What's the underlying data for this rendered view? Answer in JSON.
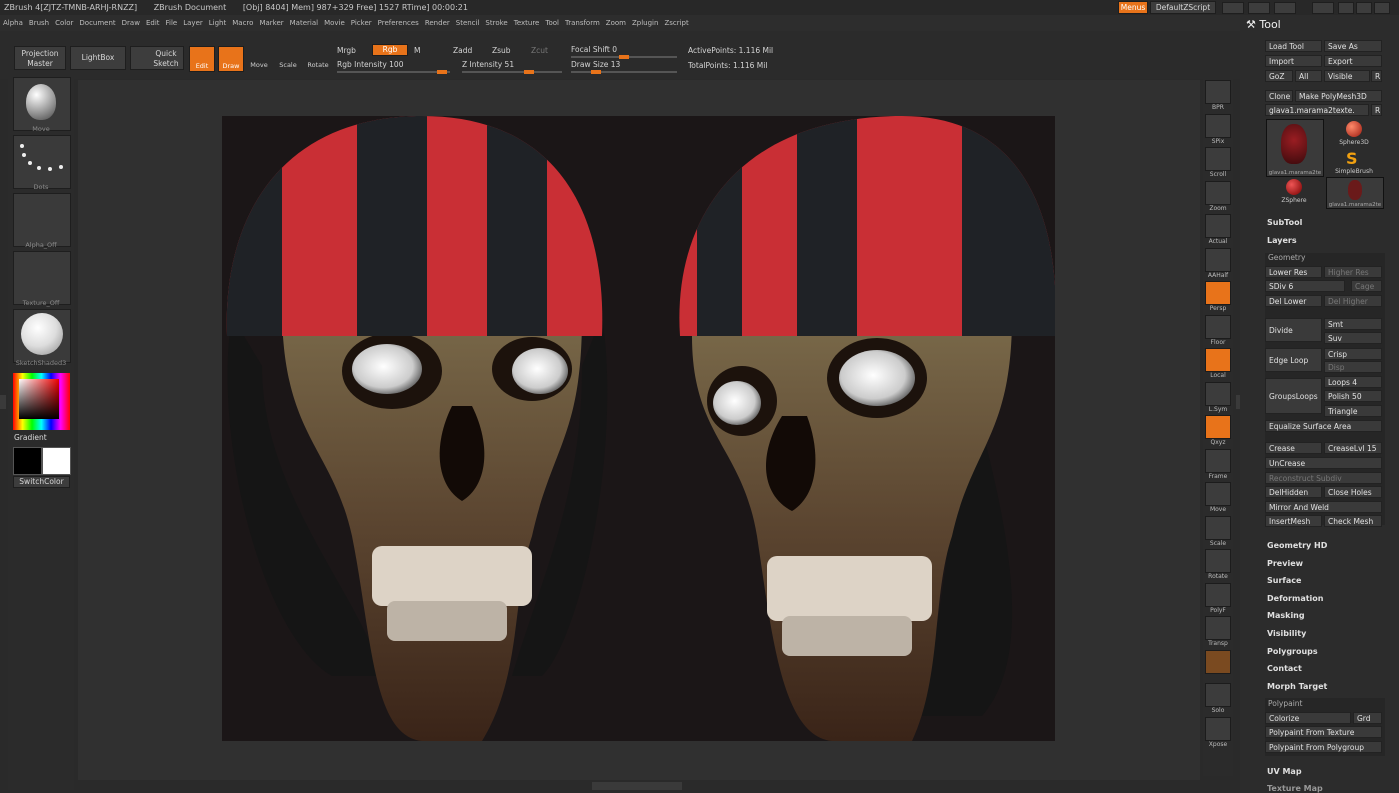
{
  "titlebar": {
    "app": "ZBrush 4[ZJTZ-TMNB-ARHJ-RNZZ]",
    "doc": "ZBrush Document",
    "stats": "[Obj] 8404] Mem] 987+329 Free] 1527 RTime] 00:00:21"
  },
  "menus_btn": "Menus",
  "script_btn": "DefaultZScript",
  "menubar": [
    "Alpha",
    "Brush",
    "Color",
    "Document",
    "Draw",
    "Edit",
    "File",
    "Layer",
    "Light",
    "Macro",
    "Marker",
    "Material",
    "Movie",
    "Picker",
    "Preferences",
    "Render",
    "Stencil",
    "Stroke",
    "Texture",
    "Tool",
    "Transform",
    "Zoom",
    "Zplugin",
    "Zscript"
  ],
  "toolbar": {
    "projection": "Projection Master",
    "lightbox": "LightBox",
    "quicksketch": "Quick Sketch",
    "edit": "Edit",
    "draw": "Draw",
    "move": "Move",
    "scale": "Scale",
    "rotate": "Rotate",
    "mrgb": "Mrgb",
    "rgb": "Rgb",
    "m": "M",
    "zadd": "Zadd",
    "zsub": "Zsub",
    "zcut": "Zcut",
    "rgb_intensity": "Rgb Intensity 100",
    "z_intensity": "Z Intensity 51",
    "focal_shift": "Focal Shift 0",
    "draw_size": "Draw Size 13",
    "active_points": "ActivePoints: 1.116 Mil",
    "total_points": "TotalPoints: 1.116 Mil"
  },
  "leftshelf": {
    "brush_label": "Move",
    "stroke_label": "Dots",
    "alpha_label": "Alpha_Off",
    "texture_label": "Texture_Off",
    "material_label": "SketchShaded3",
    "gradient": "Gradient",
    "switchcolor": "SwitchColor"
  },
  "rightnav": [
    {
      "id": "bpr",
      "label": "BPR"
    },
    {
      "id": "spix",
      "label": "SPix"
    },
    {
      "id": "scroll",
      "label": "Scroll"
    },
    {
      "id": "zoom",
      "label": "Zoom"
    },
    {
      "id": "actual",
      "label": "Actual"
    },
    {
      "id": "aahalf",
      "label": "AAHalf"
    },
    {
      "id": "persp",
      "label": "Persp"
    },
    {
      "id": "floor",
      "label": "Floor"
    },
    {
      "id": "local",
      "label": "Local"
    },
    {
      "id": "lsym",
      "label": "L.Sym"
    },
    {
      "id": "qxyz",
      "label": "Qxyz"
    },
    {
      "id": "frame",
      "label": "Frame"
    },
    {
      "id": "move",
      "label": "Move"
    },
    {
      "id": "scale",
      "label": "Scale"
    },
    {
      "id": "rotate",
      "label": "Rotate"
    },
    {
      "id": "polyf",
      "label": "PolyF"
    },
    {
      "id": "transp",
      "label": "Transp"
    },
    {
      "id": "ghost",
      "label": ""
    },
    {
      "id": "solo",
      "label": "Solo"
    },
    {
      "id": "xpose",
      "label": "Xpose"
    }
  ],
  "toolpal": {
    "title": "Tool",
    "load_tool": "Load Tool",
    "save_as": "Save As",
    "import": "Import",
    "export": "Export",
    "goz": "GoZ",
    "all": "All",
    "visible": "Visible",
    "r": "R",
    "clone": "Clone",
    "make_polymesh": "Make PolyMesh3D",
    "current_tool": "glava1.marama2texte.",
    "r2": "R",
    "tools": [
      "glava1.marama2te",
      "Sphere3D",
      "SimpleBrush",
      "ZSphere",
      "glava1.marama2te"
    ],
    "subtool": "SubTool",
    "layers": "Layers",
    "geometry": "Geometry",
    "lower_res": "Lower Res",
    "higher_res": "Higher Res",
    "sdiv": "SDiv 6",
    "cage": "Cage",
    "del_lower": "Del Lower",
    "del_higher": "Del Higher",
    "divide": "Divide",
    "smt": "Smt",
    "suv": "Suv",
    "edge_loop": "Edge Loop",
    "crisp": "Crisp",
    "disp": "Disp",
    "groupsloops": "GroupsLoops",
    "loops": "Loops 4",
    "polish": "Polish 50",
    "triangle": "Triangle",
    "equalize": "Equalize Surface Area",
    "crease": "Crease",
    "creaselvl": "CreaseLvl 15",
    "uncrease": "UnCrease",
    "reconstruct": "Reconstruct Subdiv",
    "delhidden": "DelHidden",
    "close_holes": "Close Holes",
    "mirror_weld": "Mirror And Weld",
    "insertmesh": "InsertMesh",
    "check_mesh": "Check Mesh",
    "sections": [
      "Geometry HD",
      "Preview",
      "Surface",
      "Deformation",
      "Masking",
      "Visibility",
      "Polygroups",
      "Contact",
      "Morph Target"
    ],
    "polypaint": "Polypaint",
    "colorize": "Colorize",
    "grd": "Grd",
    "pp_texture": "Polypaint From Texture",
    "pp_polygroup": "Polypaint From Polygroup",
    "uv_map": "UV Map",
    "texture_map": "Texture Map"
  },
  "colors": {
    "accent": "#e8731a",
    "bg": "#2a2a2a",
    "doc": "#1b1617"
  }
}
